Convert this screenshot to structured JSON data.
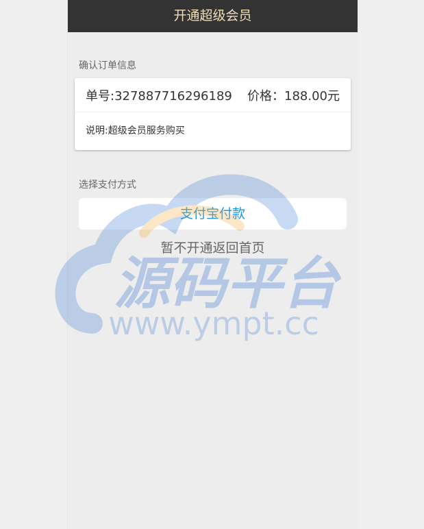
{
  "header": {
    "title": "开通超级会员"
  },
  "order": {
    "section_label": "确认订单信息",
    "number_label": "单号:327887716296189",
    "price_label": "价格：188.00元",
    "desc_label": "说明:超级会员服务购买"
  },
  "payment": {
    "section_label": "选择支付方式",
    "alipay_label": "支付宝付款",
    "back_label": "暂不开通返回首页"
  },
  "watermark": {
    "logo_text": "源码平台",
    "url_text": "www.ympt.cc"
  },
  "colors": {
    "header_bg": "#333333",
    "header_text": "#f2deb8",
    "alipay_text": "#1a95e0",
    "watermark_blue": "#4a84d6",
    "watermark_orange": "#f5b041"
  }
}
